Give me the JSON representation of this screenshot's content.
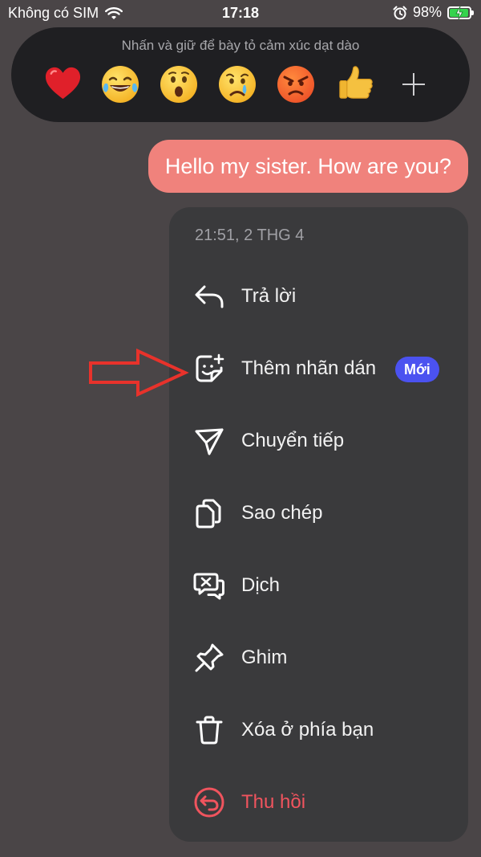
{
  "status_bar": {
    "carrier": "Không có SIM",
    "time": "17:18",
    "battery": "98%",
    "battery_level": 0.98,
    "icons": [
      "wifi-icon",
      "alarm-icon",
      "battery-charging-icon"
    ]
  },
  "reaction_bar": {
    "hint": "Nhấn và giữ để bày tỏ cảm xúc dạt dào",
    "reactions": [
      "heart",
      "laugh-tears",
      "wow",
      "cry",
      "angry",
      "thumbs-up"
    ],
    "more": "plus-icon"
  },
  "message": {
    "text": "Hello my sister. How are you?",
    "bubble_color": "#f0827c"
  },
  "menu": {
    "timestamp": "21:51, 2 THG 4",
    "items": [
      {
        "label": "Trả lời",
        "icon": "reply-icon"
      },
      {
        "label": "Thêm nhãn dán",
        "icon": "sticker-add-icon",
        "badge": "Mới"
      },
      {
        "label": "Chuyển tiếp",
        "icon": "forward-icon"
      },
      {
        "label": "Sao chép",
        "icon": "copy-icon"
      },
      {
        "label": "Dịch",
        "icon": "translate-icon"
      },
      {
        "label": "Ghim",
        "icon": "pin-icon"
      },
      {
        "label": "Xóa ở phía bạn",
        "icon": "trash-icon"
      },
      {
        "label": "Thu hồi",
        "icon": "unsend-icon",
        "color": "#f0545e"
      }
    ]
  },
  "colors": {
    "background": "#4a4547",
    "menu_bg": "#3a3a3c",
    "badge": "#4b52f0",
    "annotation": "#e8322b"
  }
}
